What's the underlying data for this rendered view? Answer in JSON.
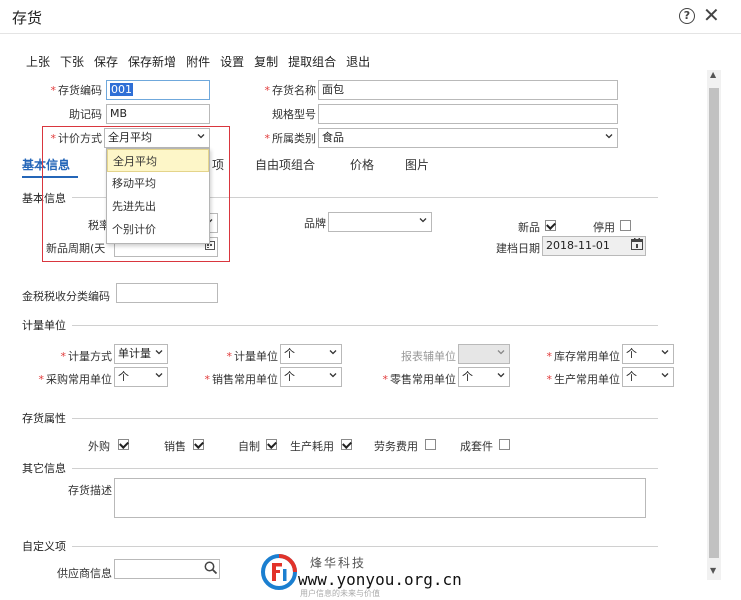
{
  "window": {
    "title": "存货"
  },
  "toolbar": [
    "上张",
    "下张",
    "保存",
    "保存新增",
    "附件",
    "设置",
    "复制",
    "提取组合",
    "退出"
  ],
  "header_fields": {
    "inventory_code": {
      "label": "存货编码",
      "value": "001",
      "required": true
    },
    "inventory_name": {
      "label": "存货名称",
      "value": "面包",
      "required": true
    },
    "mnemonic_code": {
      "label": "助记码",
      "value": "MB"
    },
    "spec_model": {
      "label": "规格型号",
      "value": ""
    },
    "valuation_method": {
      "label": "计价方式",
      "value": "全月平均",
      "required": true
    },
    "category": {
      "label": "所属类别",
      "value": "食品",
      "required": true
    }
  },
  "valuation_options": [
    "全月平均",
    "移动平均",
    "先进先出",
    "个别计价"
  ],
  "tabs": [
    "基本信息",
    "项",
    "自由项组合",
    "价格",
    "图片"
  ],
  "basic_info": {
    "section_title": "基本信息",
    "tax_rate_label": "税率",
    "brand_label": "品牌",
    "new_product_label": "新品",
    "disabled_label": "停用",
    "new_cycle_label": "新品周期(天",
    "created_date_label": "建档日期",
    "created_date_value": "2018-11-01",
    "tax_code_label": "金税税收分类编码"
  },
  "unit_section": {
    "section_title": "计量单位",
    "measure_method": {
      "label": "计量方式",
      "value": "单计量"
    },
    "measure_unit": {
      "label": "计量单位",
      "value": "个"
    },
    "report_aux_unit": {
      "label": "报表辅单位",
      "value": ""
    },
    "stock_unit": {
      "label": "库存常用单位",
      "value": "个"
    },
    "purchase_unit": {
      "label": "采购常用单位",
      "value": "个"
    },
    "sales_unit": {
      "label": "销售常用单位",
      "value": "个"
    },
    "retail_unit": {
      "label": "零售常用单位",
      "value": "个"
    },
    "production_unit": {
      "label": "生产常用单位",
      "value": "个"
    }
  },
  "attributes": {
    "section_title": "存货属性",
    "items": [
      {
        "label": "外购",
        "checked": true
      },
      {
        "label": "销售",
        "checked": true
      },
      {
        "label": "自制",
        "checked": true
      },
      {
        "label": "生产耗用",
        "checked": true
      },
      {
        "label": "劳务费用",
        "checked": false
      },
      {
        "label": "成套件",
        "checked": false
      }
    ]
  },
  "other_info": {
    "section_title": "其它信息",
    "description_label": "存货描述"
  },
  "custom": {
    "section_title": "自定义项",
    "supplier_label": "供应商信息"
  },
  "watermark": {
    "cn": "烽华科技",
    "url": "www.yonyou.org.cn",
    "sub": "用户信息的未来与价值"
  }
}
